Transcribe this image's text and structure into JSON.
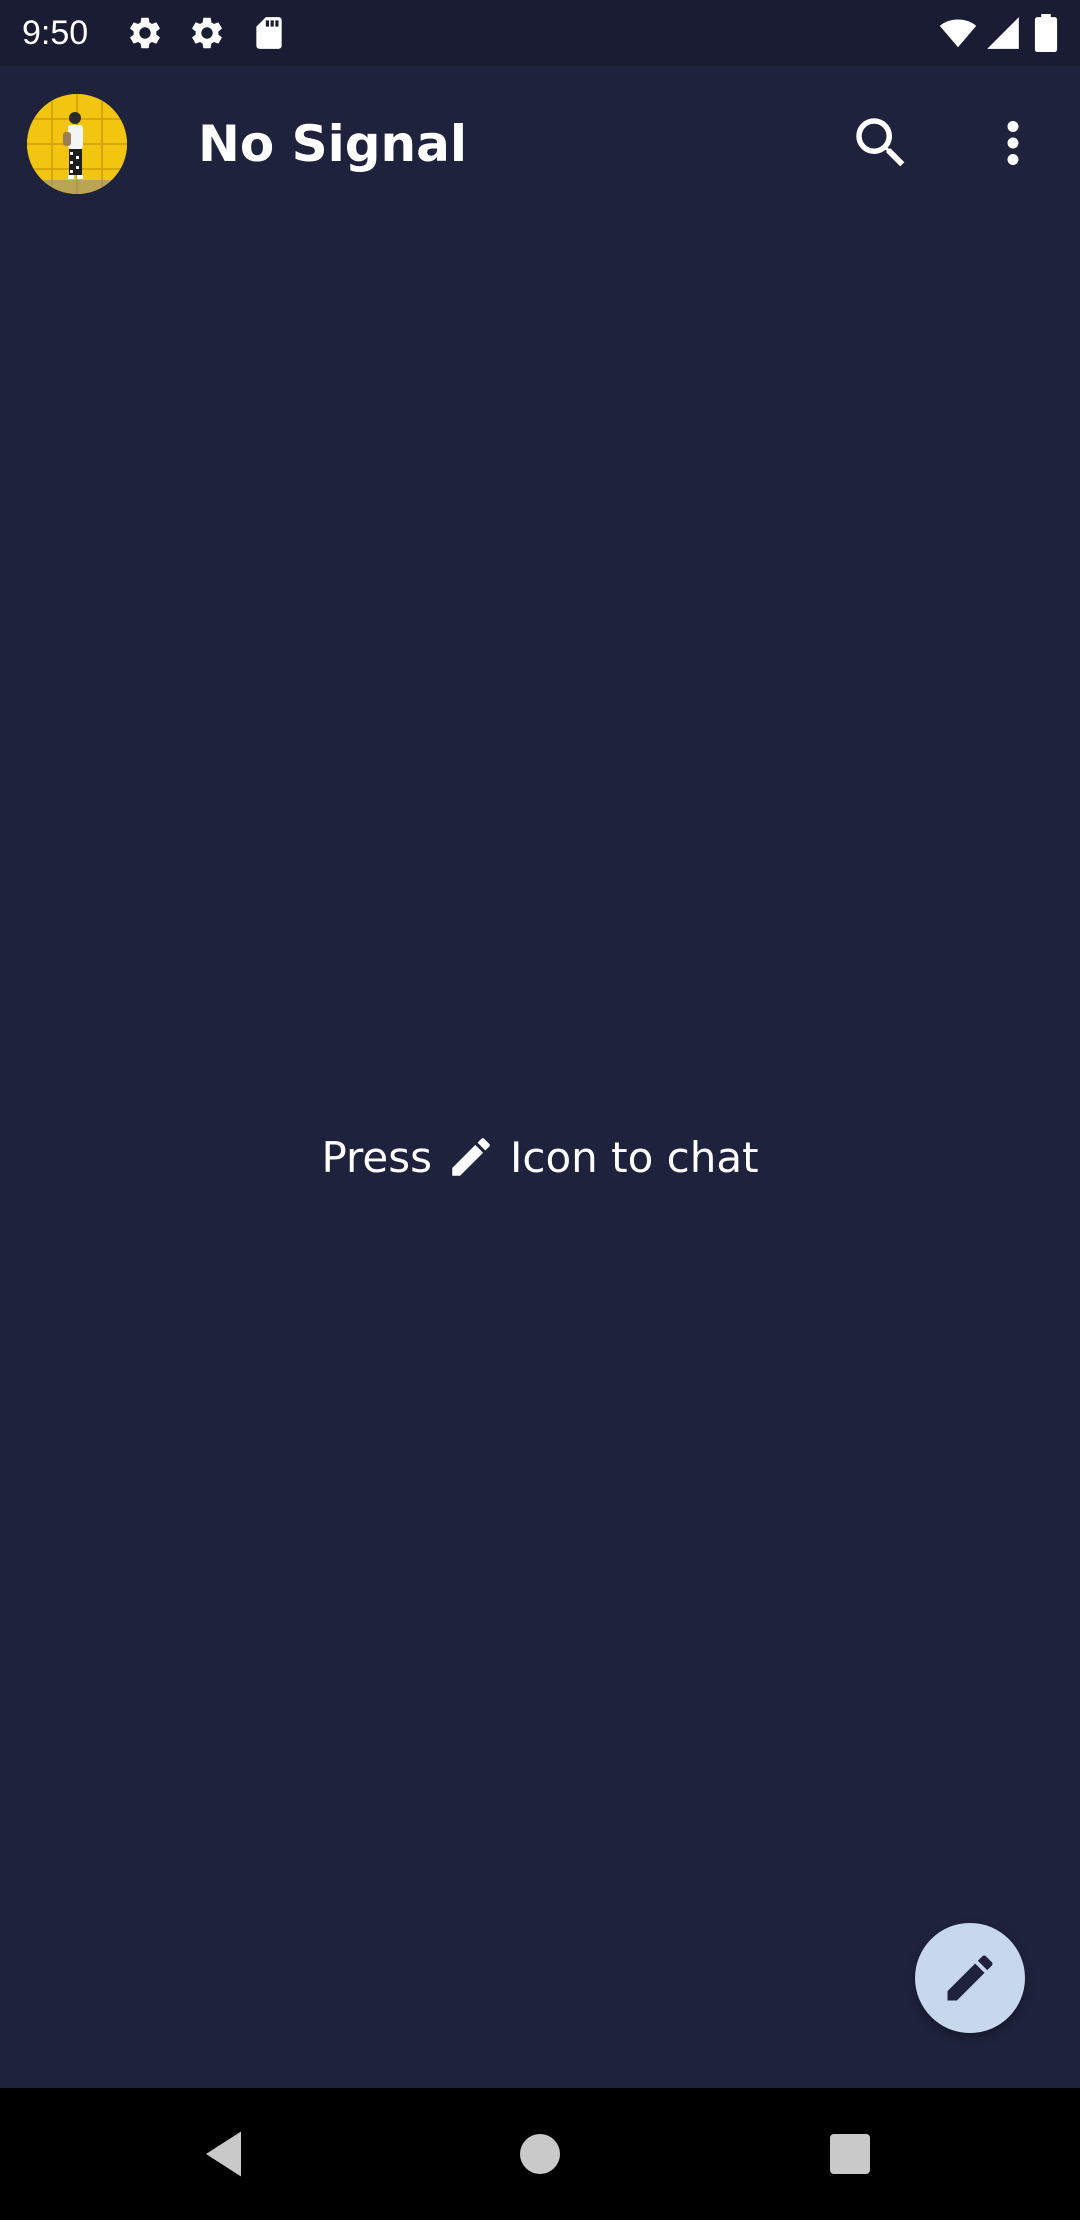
{
  "status_bar": {
    "time": "9:50",
    "left_icons": [
      "gear-icon",
      "gear-icon",
      "sd-card-icon"
    ],
    "right_icons": [
      "wifi-icon",
      "cellular-signal-icon",
      "battery-icon"
    ]
  },
  "app_bar": {
    "title": "No Signal",
    "actions": [
      "search-icon",
      "more-vert-icon"
    ]
  },
  "empty_state": {
    "prefix": "Press",
    "icon": "pencil-icon",
    "suffix": "Icon to chat"
  },
  "fab": {
    "icon": "pencil-icon"
  },
  "nav_bar": {
    "buttons": [
      "back-icon",
      "home-icon",
      "recents-icon"
    ]
  },
  "colors": {
    "background": "#1f223d",
    "status_bar": "#1a1c33",
    "fab": "#c7d8ec",
    "nav_bar": "#000000"
  }
}
